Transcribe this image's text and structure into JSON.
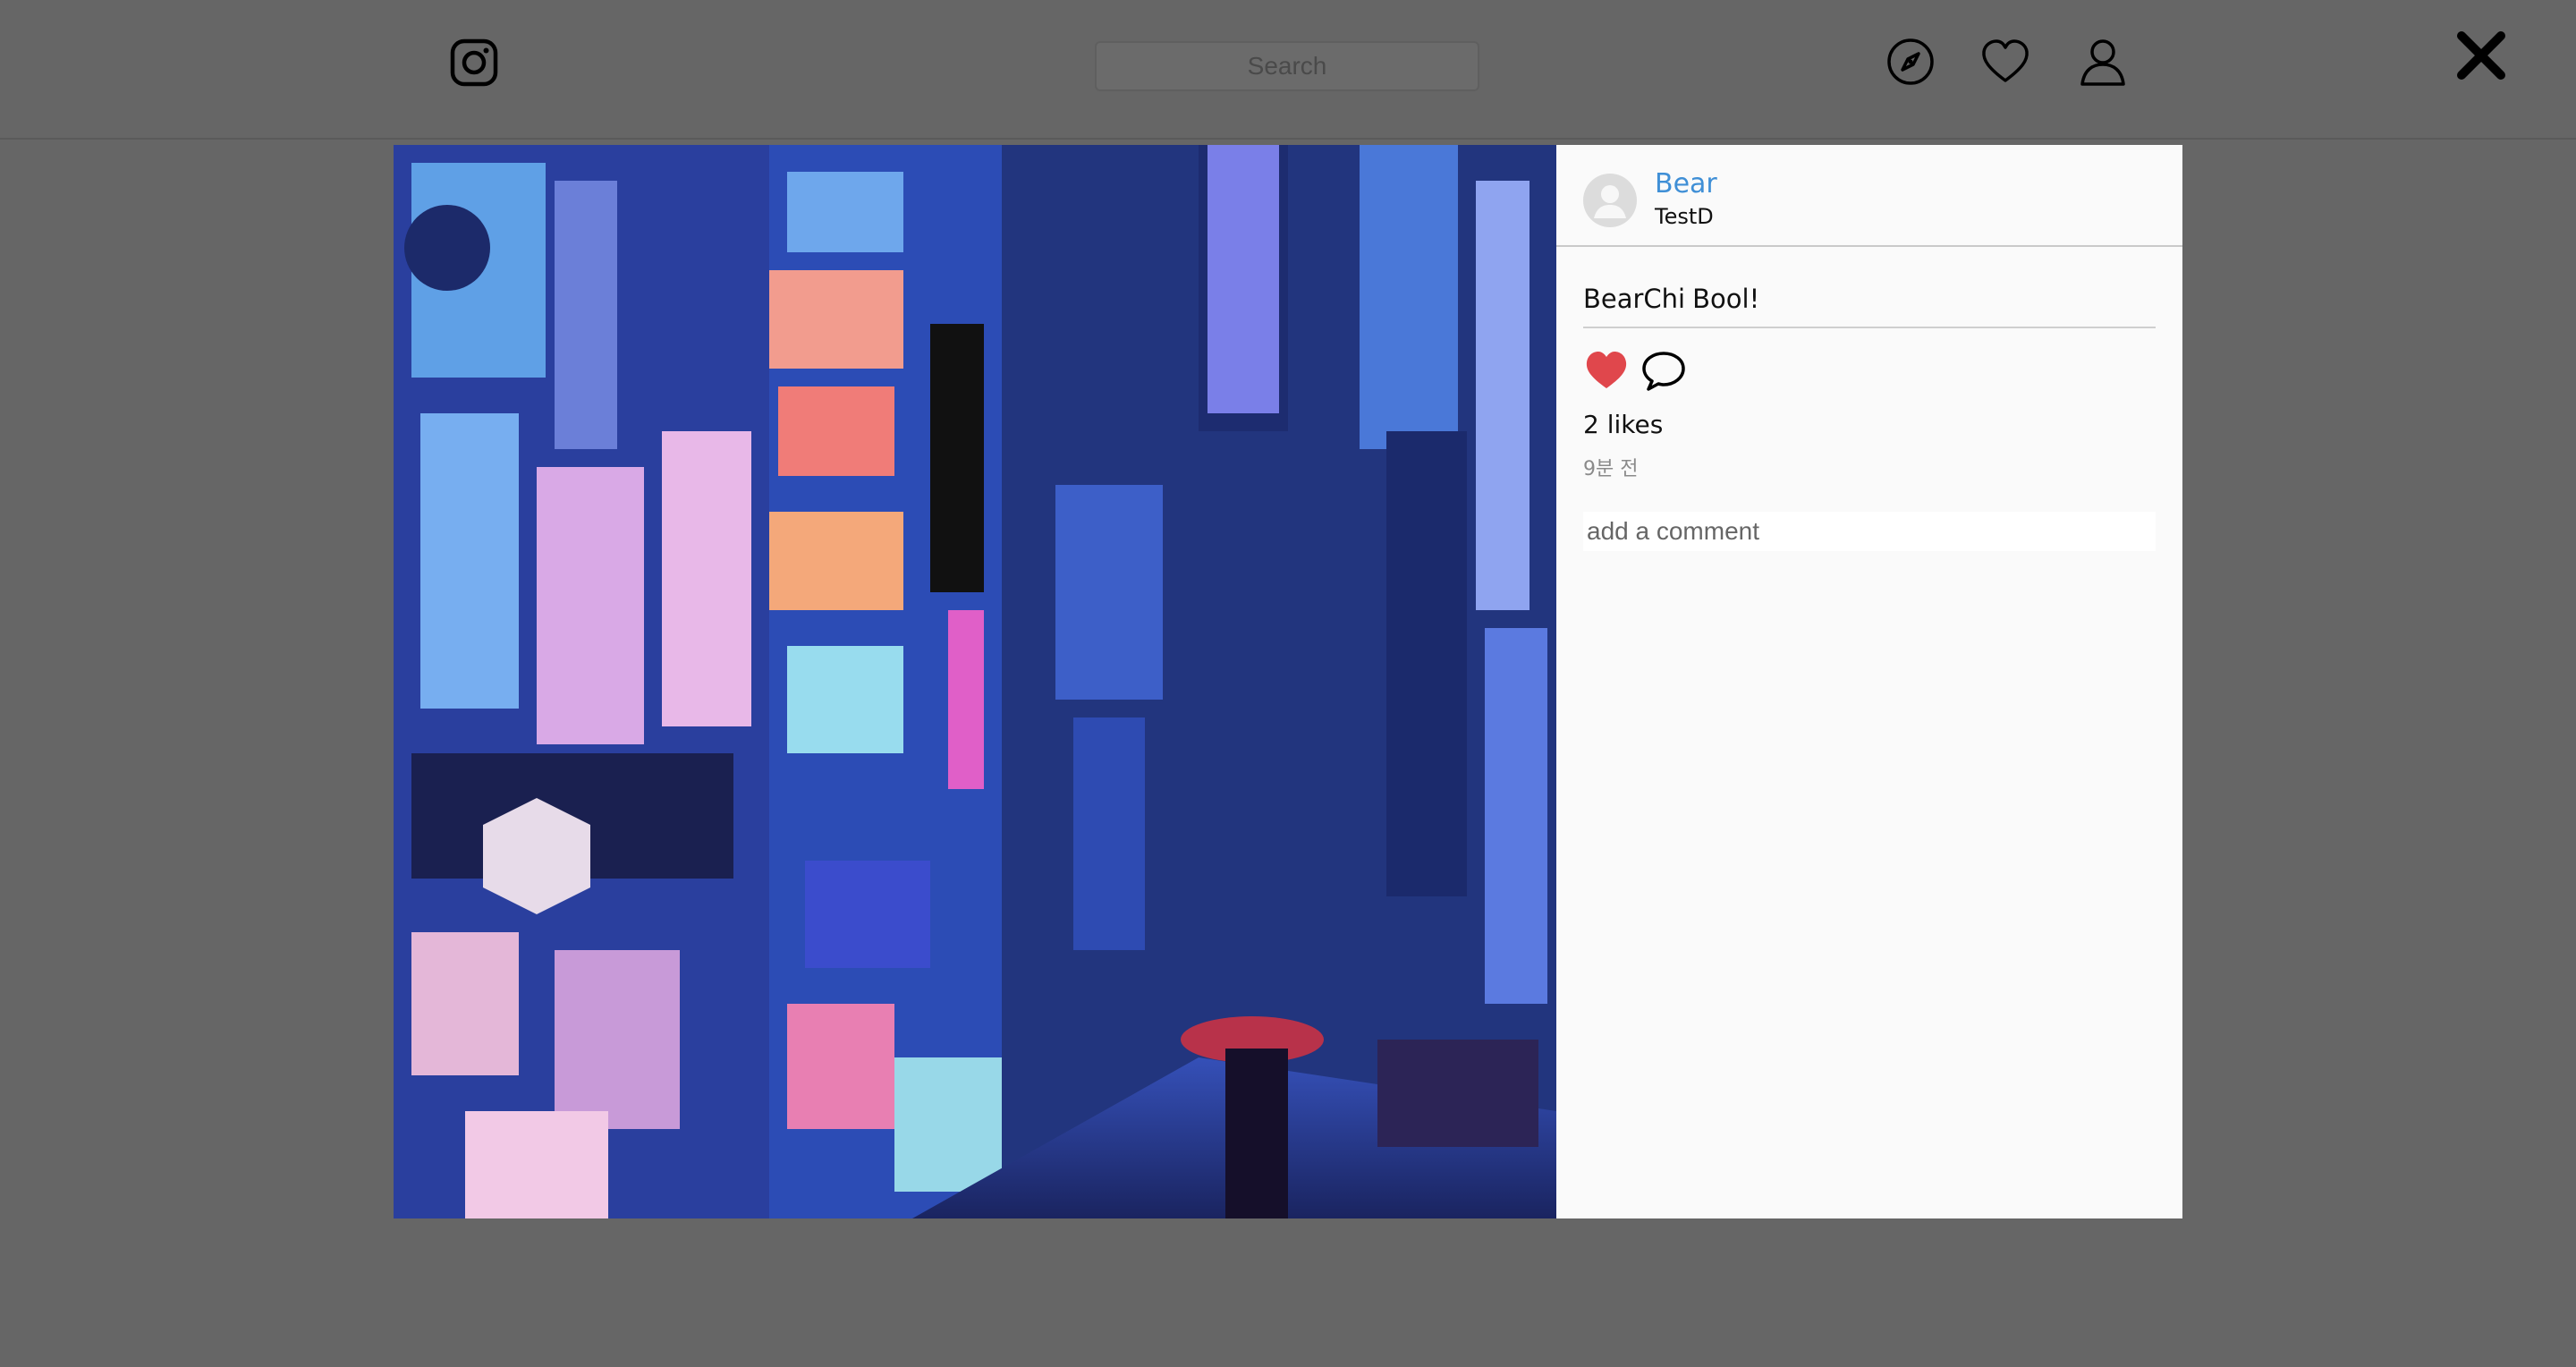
{
  "topnav": {
    "logo_icon": "instagram-icon",
    "search_placeholder": "Search",
    "icons": [
      "compass-icon",
      "heart-icon",
      "user-icon"
    ]
  },
  "overlay": {
    "close_icon": "close-icon"
  },
  "post": {
    "image_description_icon": "photo",
    "author": {
      "name": "Bear",
      "location": "TestD"
    },
    "caption": {
      "username": "BearChi",
      "text": "Bool!"
    },
    "liked": true,
    "likes_text": "2 likes",
    "time_ago": "9분 전",
    "comment_placeholder": "add a comment"
  },
  "colors": {
    "backdrop": "#666666",
    "panel": "#fafafa",
    "author_link": "#3f8fd6",
    "like_red": "#e0474c"
  }
}
